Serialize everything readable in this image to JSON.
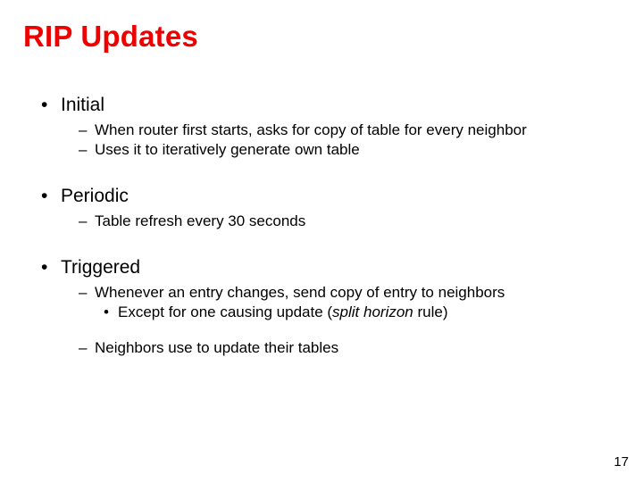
{
  "title": "RIP Updates",
  "sections": [
    {
      "heading": "Initial",
      "items": [
        {
          "text": "When router first starts, asks for copy of table for every neighbor"
        },
        {
          "text": "Uses it to iteratively generate own table"
        }
      ]
    },
    {
      "heading": "Periodic",
      "items": [
        {
          "text": "Table refresh every 30 seconds"
        }
      ]
    },
    {
      "heading": "Triggered",
      "items": [
        {
          "text": "Whenever an entry changes, send copy of entry to neighbors",
          "sub": [
            {
              "pre": "Except for one causing update (",
              "em": "split horizon",
              "post": " rule)"
            }
          ]
        },
        {
          "gap": true
        },
        {
          "text": "Neighbors use to update their tables"
        }
      ]
    }
  ],
  "page_number": "17"
}
